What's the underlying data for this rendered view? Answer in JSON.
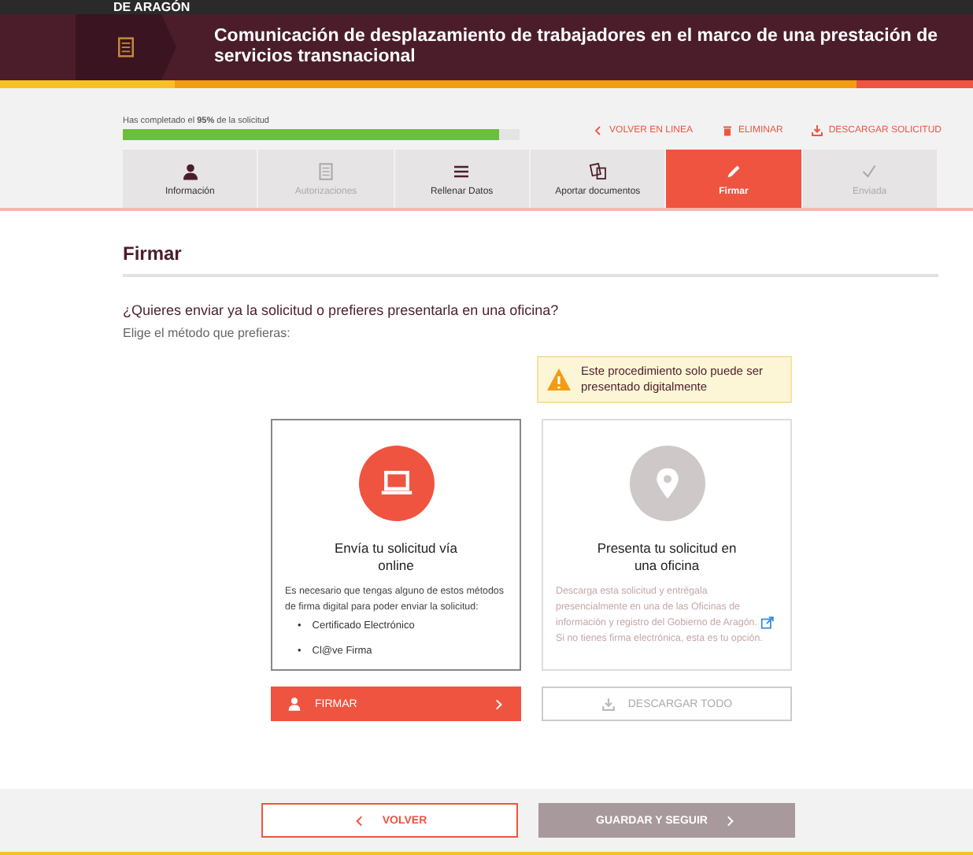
{
  "top_bar": {
    "logo": "DE ARAGÓN"
  },
  "header": {
    "title": "Comunicación de desplazamiento de trabajadores en el marco de una prestación de servicios transnacional"
  },
  "progress": {
    "label": "Has completado el **95%** de la solicitud",
    "level": 0.95
  },
  "actions": [
    {
      "kind": "back",
      "label": "VOLVER EN LINEA"
    },
    {
      "kind": "delete",
      "label": "ELIMINAR"
    },
    {
      "kind": "download",
      "label": "DESCARGAR SOLICITUD"
    }
  ],
  "steps": [
    {
      "kind": "person",
      "label": "Información",
      "selected": false,
      "disabled": false
    },
    {
      "kind": "doc",
      "label": "Autorizaciones",
      "selected": false,
      "disabled": true
    },
    {
      "kind": "list",
      "label": "Rellenar Datos",
      "selected": false,
      "disabled": false
    },
    {
      "kind": "docs",
      "label": "Aportar documentos",
      "selected": false,
      "disabled": false
    },
    {
      "kind": "pencil",
      "label": "Firmar",
      "selected": true,
      "disabled": false
    },
    {
      "kind": "check",
      "label": "Enviada",
      "selected": false,
      "disabled": true
    }
  ],
  "section_title": "Firmar",
  "question": "¿Quieres enviar ya la solicitud o prefieres presentarla en una oficina?",
  "subtitle": "Elige el método que prefieras:",
  "warning": "Este procedimiento solo puede ser presentado digitalmente",
  "options": [
    {
      "kind": "online",
      "disabled": false,
      "title": "Envía tu solicitud vía online",
      "text": "Es necesario que tengas alguno de estos métodos de firma digital para poder enviar la solicitud:",
      "bullets": [
        {
          "marker": "•",
          "text": "Certificado Electrónico"
        },
        {
          "marker": "•",
          "text": "Cl@ve Firma"
        }
      ],
      "button": "FIRMAR"
    },
    {
      "kind": "office",
      "disabled": true,
      "title": "Presenta tu solicitud en una oficina",
      "text": "Descarga esta solicitud y entrégala presencialmente en una de las Oficinas de información y registro del Gobierno de Aragón.",
      "text_after": "Si no tienes firma electrónica, esta es tu opción.",
      "button": "DESCARGAR TODO"
    }
  ],
  "footer": [
    {
      "kind": "back",
      "label": "VOLVER",
      "disabled": false
    },
    {
      "kind": "next",
      "label": "GUARDAR Y SEGUIR",
      "disabled": true
    }
  ]
}
